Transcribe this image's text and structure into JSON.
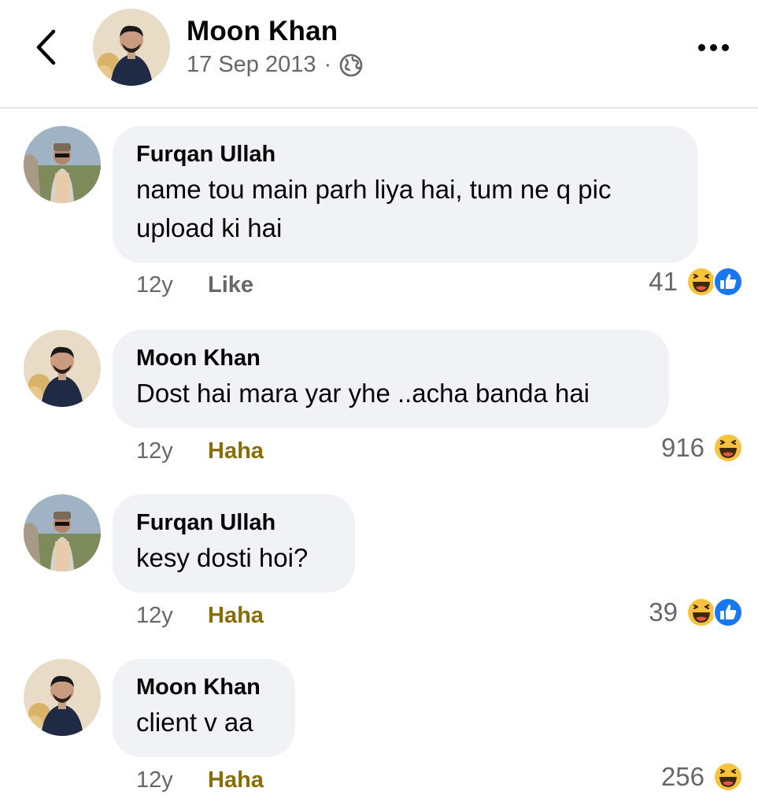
{
  "post": {
    "author": "Moon Khan",
    "date": "17 Sep 2013",
    "separator": "·",
    "privacy_icon": "globe-icon"
  },
  "icons": {
    "back": "chevron-left-icon",
    "more": "more-horizontal-icon",
    "haha": "haha-reaction-icon",
    "like": "like-reaction-icon"
  },
  "colors": {
    "secondary_text": "#65676b",
    "bubble_bg": "#f0f2f5",
    "haha_action": "#8a6d0b",
    "like_blue": "#1877f2",
    "haha_yellow": "#f7c33c"
  },
  "comments": [
    {
      "author": "Furqan Ullah",
      "text_lines": [
        "name tou main parh liya hai, tum ne q pic",
        "upload ki hai"
      ],
      "time": "12y",
      "action": "Like",
      "reaction_count": "41",
      "reactions": [
        "haha",
        "like"
      ]
    },
    {
      "author": "Moon Khan",
      "text_lines": [
        "Dost hai mara yar yhe ..acha banda hai"
      ],
      "time": "12y",
      "action": "Haha",
      "reaction_count": "916",
      "reactions": [
        "haha"
      ]
    },
    {
      "author": "Furqan Ullah",
      "text_lines": [
        "kesy dosti hoi?"
      ],
      "time": "12y",
      "action": "Haha",
      "reaction_count": "39",
      "reactions": [
        "haha",
        "like"
      ]
    },
    {
      "author": "Moon Khan",
      "text_lines": [
        "client v aa"
      ],
      "time": "12y",
      "action": "Haha",
      "reaction_count": "256",
      "reactions": [
        "haha"
      ]
    }
  ]
}
